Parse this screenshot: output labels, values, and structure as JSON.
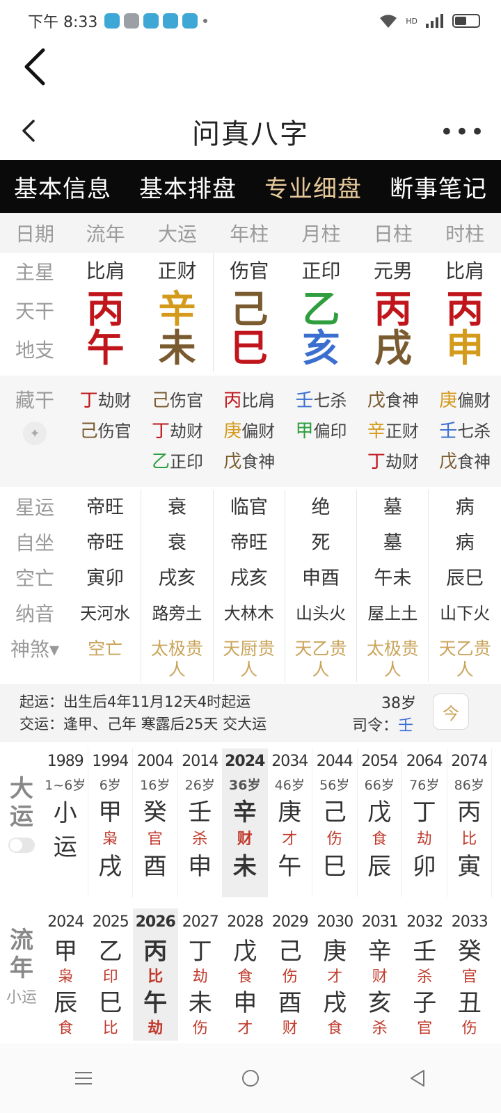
{
  "status": {
    "time": "下午 8:33",
    "signal_label": "HD"
  },
  "header": {
    "title": "问真八字"
  },
  "tabs": [
    {
      "label": "基本信息"
    },
    {
      "label": "基本排盘"
    },
    {
      "label": "专业细盘"
    },
    {
      "label": "断事笔记"
    }
  ],
  "columns": [
    "日期",
    "流年",
    "大运",
    "年柱",
    "月柱",
    "日柱",
    "时柱"
  ],
  "row_labels": {
    "main_star": "主星",
    "stem": "天干",
    "branch": "地支",
    "hidden": "藏干",
    "xingyun": "星运",
    "zizuo": "自坐",
    "kongwang": "空亡",
    "nayin": "纳音",
    "shensha": "神煞▾"
  },
  "pillars": [
    {
      "star": "比肩",
      "stem": "丙",
      "stem_color": "#c0161b",
      "branch": "午",
      "branch_color": "#c0161b"
    },
    {
      "star": "正财",
      "stem": "辛",
      "stem_color": "#d49a1c",
      "branch": "未",
      "branch_color": "#7a5b2f"
    },
    {
      "star": "伤官",
      "stem": "己",
      "stem_color": "#7a5b2f",
      "branch": "巳",
      "branch_color": "#c0161b"
    },
    {
      "star": "正印",
      "stem": "乙",
      "stem_color": "#2e9e3f",
      "branch": "亥",
      "branch_color": "#3a6fd0"
    },
    {
      "star": "元男",
      "stem": "丙",
      "stem_color": "#c0161b",
      "branch": "戌",
      "branch_color": "#7a5b2f"
    },
    {
      "star": "比肩",
      "stem": "丙",
      "stem_color": "#c0161b",
      "branch": "申",
      "branch_color": "#d49a1c"
    }
  ],
  "hidden_stems": [
    [
      {
        "s": "丁",
        "c": "#c0161b",
        "t": "劫财"
      },
      {
        "s": "己",
        "c": "#7a5b2f",
        "t": "伤官"
      }
    ],
    [
      {
        "s": "己",
        "c": "#7a5b2f",
        "t": "伤官"
      },
      {
        "s": "丁",
        "c": "#c0161b",
        "t": "劫财"
      },
      {
        "s": "乙",
        "c": "#2e9e3f",
        "t": "正印"
      }
    ],
    [
      {
        "s": "丙",
        "c": "#c0161b",
        "t": "比肩"
      },
      {
        "s": "庚",
        "c": "#d49a1c",
        "t": "偏财"
      },
      {
        "s": "戊",
        "c": "#7a5b2f",
        "t": "食神"
      }
    ],
    [
      {
        "s": "壬",
        "c": "#3a6fd0",
        "t": "七杀"
      },
      {
        "s": "甲",
        "c": "#2e9e3f",
        "t": "偏印"
      }
    ],
    [
      {
        "s": "戊",
        "c": "#7a5b2f",
        "t": "食神"
      },
      {
        "s": "辛",
        "c": "#d49a1c",
        "t": "正财"
      },
      {
        "s": "丁",
        "c": "#c0161b",
        "t": "劫财"
      }
    ],
    [
      {
        "s": "庚",
        "c": "#d49a1c",
        "t": "偏财"
      },
      {
        "s": "壬",
        "c": "#3a6fd0",
        "t": "七杀"
      },
      {
        "s": "戊",
        "c": "#7a5b2f",
        "t": "食神"
      }
    ]
  ],
  "info": [
    {
      "xingyun": "帝旺",
      "zizuo": "帝旺",
      "kongwang": "寅卯",
      "nayin": "天河水",
      "shensha": "空亡"
    },
    {
      "xingyun": "衰",
      "zizuo": "衰",
      "kongwang": "戌亥",
      "nayin": "路旁土",
      "shensha": "太极贵人"
    },
    {
      "xingyun": "临官",
      "zizuo": "帝旺",
      "kongwang": "戌亥",
      "nayin": "大林木",
      "shensha": "天厨贵人"
    },
    {
      "xingyun": "绝",
      "zizuo": "死",
      "kongwang": "申酉",
      "nayin": "山头火",
      "shensha": "天乙贵人"
    },
    {
      "xingyun": "墓",
      "zizuo": "墓",
      "kongwang": "午未",
      "nayin": "屋上土",
      "shensha": "太极贵人"
    },
    {
      "xingyun": "病",
      "zizuo": "病",
      "kongwang": "辰巳",
      "nayin": "山下火",
      "shensha": "天乙贵人"
    }
  ],
  "qiyun": {
    "line1": "起运：出生后4年11月12天4时起运",
    "line2": "交运：逢甲、己年 寒露后25天 交大运",
    "age": "38岁",
    "siling_label": "司令：",
    "siling_value": "壬",
    "calendar_icon": "今"
  },
  "dayun": {
    "label1": "大",
    "label2": "运",
    "items": [
      {
        "year": "1989",
        "age": "1~6岁",
        "g1": "小",
        "gd": "",
        "g2": "运"
      },
      {
        "year": "1994",
        "age": "6岁",
        "g1": "甲",
        "gd": "枭",
        "g2": "戌"
      },
      {
        "year": "2004",
        "age": "16岁",
        "g1": "癸",
        "gd": "官",
        "g2": "酉"
      },
      {
        "year": "2014",
        "age": "26岁",
        "g1": "壬",
        "gd": "杀",
        "g2": "申"
      },
      {
        "year": "2024",
        "age": "36岁",
        "g1": "辛",
        "gd": "财",
        "g2": "未"
      },
      {
        "year": "2034",
        "age": "46岁",
        "g1": "庚",
        "gd": "才",
        "g2": "午"
      },
      {
        "year": "2044",
        "age": "56岁",
        "g1": "己",
        "gd": "伤",
        "g2": "巳"
      },
      {
        "year": "2054",
        "age": "66岁",
        "g1": "戊",
        "gd": "食",
        "g2": "辰"
      },
      {
        "year": "2064",
        "age": "76岁",
        "g1": "丁",
        "gd": "劫",
        "g2": "卯"
      },
      {
        "year": "2074",
        "age": "86岁",
        "g1": "丙",
        "gd": "比",
        "g2": "寅"
      }
    ]
  },
  "liunian": {
    "label1": "流",
    "label2": "年",
    "sub": "小运",
    "items": [
      {
        "year": "2024",
        "g1": "甲",
        "gd": "枭",
        "g2": "辰",
        "gd2": "食"
      },
      {
        "year": "2025",
        "g1": "乙",
        "gd": "印",
        "g2": "巳",
        "gd2": "比"
      },
      {
        "year": "2026",
        "g1": "丙",
        "gd": "比",
        "g2": "午",
        "gd2": "劫"
      },
      {
        "year": "2027",
        "g1": "丁",
        "gd": "劫",
        "g2": "未",
        "gd2": "伤"
      },
      {
        "year": "2028",
        "g1": "戊",
        "gd": "食",
        "g2": "申",
        "gd2": "才"
      },
      {
        "year": "2029",
        "g1": "己",
        "gd": "伤",
        "g2": "酉",
        "gd2": "财"
      },
      {
        "year": "2030",
        "g1": "庚",
        "gd": "才",
        "g2": "戌",
        "gd2": "食"
      },
      {
        "year": "2031",
        "g1": "辛",
        "gd": "财",
        "g2": "亥",
        "gd2": "杀"
      },
      {
        "year": "2032",
        "g1": "壬",
        "gd": "杀",
        "g2": "子",
        "gd2": "官"
      },
      {
        "year": "2033",
        "g1": "癸",
        "gd": "官",
        "g2": "丑",
        "gd2": "伤"
      }
    ]
  }
}
